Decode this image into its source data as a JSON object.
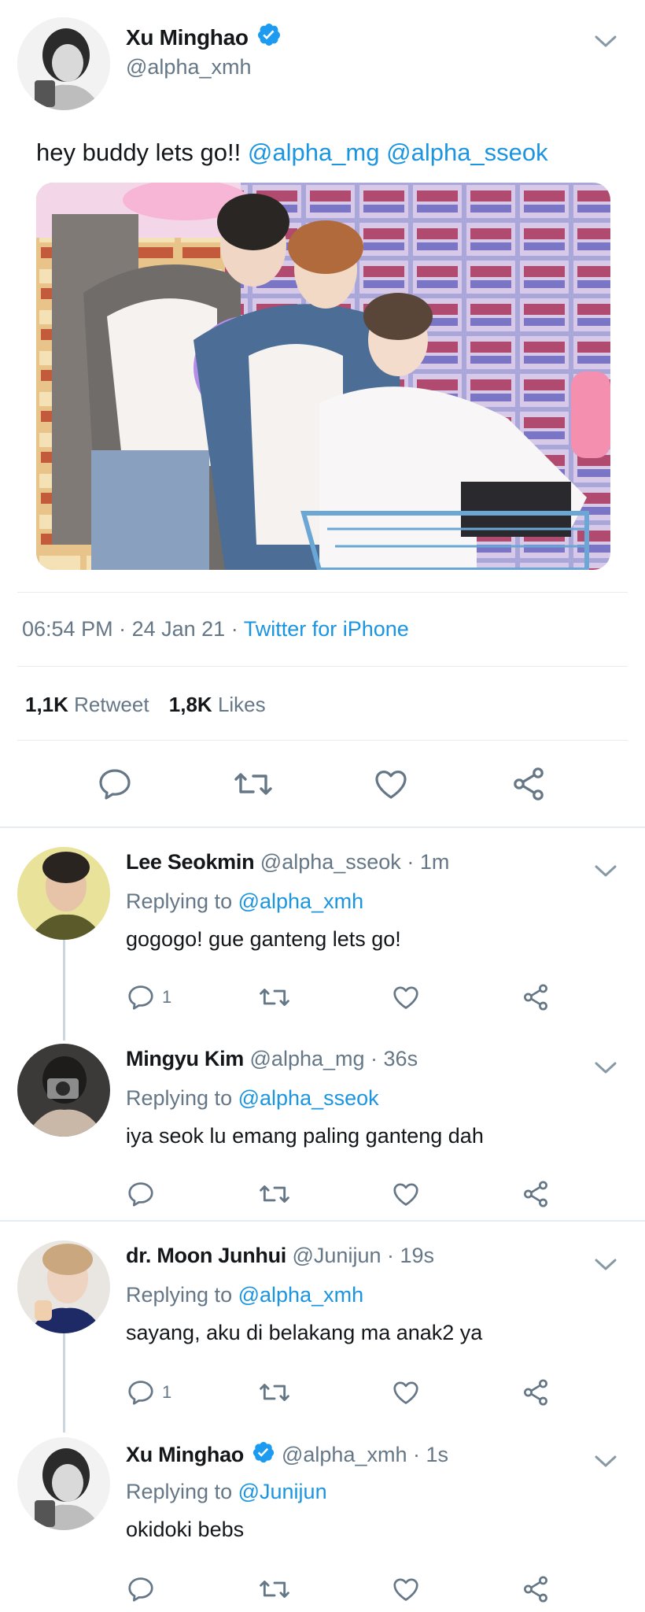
{
  "colors": {
    "link": "#1b95e0",
    "muted": "#657786",
    "verified": "#1d9bf0",
    "divider": "#e6ecf0"
  },
  "main_tweet": {
    "author_name": "Xu Minghao",
    "handle": "@alpha_xmh",
    "text_prefix": "hey buddy lets go!!",
    "mentions": [
      "@alpha_mg",
      "@alpha_sseok"
    ],
    "time": "06:54 PM",
    "date": "24 Jan 21",
    "source": "Twitter for iPhone",
    "retweets_count": "1,1K",
    "retweets_label": "Retweet",
    "likes_count": "1,8K",
    "likes_label": "Likes",
    "icons": [
      "reply-icon",
      "retweet-icon",
      "like-icon",
      "share-icon"
    ]
  },
  "replies": [
    {
      "name": "Lee Seokmin",
      "handle": "@alpha_sseok",
      "time": "1m",
      "replying_label": "Replying to",
      "replying_to": "@alpha_xmh",
      "text": "gogogo! gue ganteng lets go!",
      "reply_count": "1",
      "verified": false
    },
    {
      "name": "Mingyu Kim",
      "handle": "@alpha_mg",
      "time": "36s",
      "replying_label": "Replying to",
      "replying_to": "@alpha_sseok",
      "text": "iya seok lu emang paling ganteng dah",
      "reply_count": "",
      "verified": false
    },
    {
      "name": "dr. Moon Junhui",
      "handle": "@Junijun",
      "time": "19s",
      "replying_label": "Replying to",
      "replying_to": "@alpha_xmh",
      "text": "sayang, aku di belakang ma anak2 ya",
      "reply_count": "1",
      "verified": false
    },
    {
      "name": "Xu Minghao",
      "handle": "@alpha_xmh",
      "time": "1s",
      "replying_label": "Replying to",
      "replying_to": "@Junijun",
      "text": "okidoki bebs",
      "reply_count": "",
      "verified": true
    }
  ]
}
